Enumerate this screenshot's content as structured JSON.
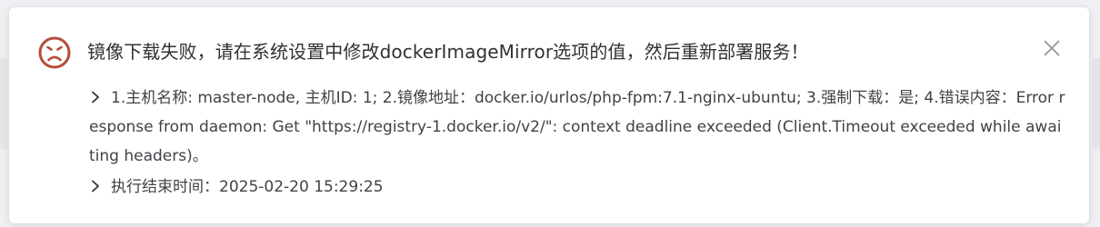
{
  "notification": {
    "title": "镜像下载失败，请在系统设置中修改dockerImageMirror选项的值，然后重新部署服务！",
    "details": [
      "1.主机名称: master-node, 主机ID: 1; 2.镜像地址：docker.io/urlos/php-fpm:7.1-nginx-ubuntu; 3.强制下载：是; 4.错误内容：Error response from daemon: Get \"https://registry-1.docker.io/v2/\": context deadline exceeded (Client.Timeout exceeded while awaiting headers)。",
      "执行结束时间：2025-02-20 15:29:25"
    ],
    "icons": {
      "status": "sad-face-error-icon",
      "close": "close-icon",
      "bullet": "chevron-right-icon"
    },
    "colors": {
      "error": "#b44d3a",
      "text": "#303133",
      "icon_gray": "#909399"
    }
  }
}
